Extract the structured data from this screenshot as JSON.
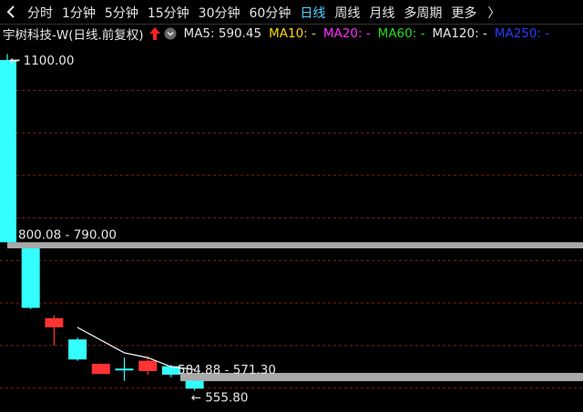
{
  "toolbar": {
    "tabs": [
      "分时",
      "1分钟",
      "5分钟",
      "15分钟",
      "30分钟",
      "60分钟",
      "日线",
      "周线",
      "月线",
      "多周期",
      "更多"
    ],
    "active_tab": "日线",
    "more_chevron": "〉"
  },
  "legend": {
    "title": "宇树科技-W(日线.前复权)",
    "ma5": "MA5: 590.45",
    "ma10": "MA10: -",
    "ma20": "MA20: -",
    "ma60": "MA60: -",
    "ma120": "MA120: -",
    "ma250": "MA250: -"
  },
  "colors": {
    "up": "#ff3333",
    "down": "#33ffff",
    "ma5": "#ffffff",
    "band": "#a9a9a9",
    "grid": "#8b1a1a"
  },
  "chart_data": {
    "type": "candlestick",
    "ylim": [
      540,
      1115
    ],
    "candles": [
      {
        "open": 1100,
        "high": 1110,
        "low": 810,
        "close": 800,
        "dir": "down"
      },
      {
        "open": 790,
        "high": 790,
        "low": 690,
        "close": 692,
        "dir": "down"
      },
      {
        "open": 660,
        "high": 680,
        "low": 630,
        "close": 675,
        "dir": "up"
      },
      {
        "open": 640,
        "high": 643,
        "low": 605,
        "close": 607,
        "dir": "down"
      },
      {
        "open": 583,
        "high": 600,
        "low": 585,
        "close": 600,
        "dir": "up"
      },
      {
        "open": 592,
        "high": 610,
        "low": 572,
        "close": 592,
        "dir": "down"
      },
      {
        "open": 588,
        "high": 612,
        "low": 582,
        "close": 605,
        "dir": "up"
      },
      {
        "open": 596,
        "high": 598,
        "low": 578,
        "close": 582,
        "dir": "down"
      },
      {
        "open": 572,
        "high": 572,
        "low": 556,
        "close": 559,
        "dir": "down"
      }
    ],
    "ma5": [
      {
        "i": 4,
        "value": 660
      },
      {
        "i": 5,
        "value": 618
      },
      {
        "i": 6,
        "value": 610
      },
      {
        "i": 7,
        "value": 595
      },
      {
        "i": 8,
        "value": 590.45
      }
    ],
    "gap_bands": [
      {
        "high": 800.08,
        "low": 790.0,
        "label": "800.08 - 790.00"
      },
      {
        "high": 584.88,
        "low": 571.3,
        "label": "584.88 - 571.30"
      }
    ],
    "high_label": "1100.00",
    "low_label": "555.80",
    "grid_values": [
      1050,
      980,
      910,
      840,
      770,
      700,
      630,
      560
    ]
  }
}
